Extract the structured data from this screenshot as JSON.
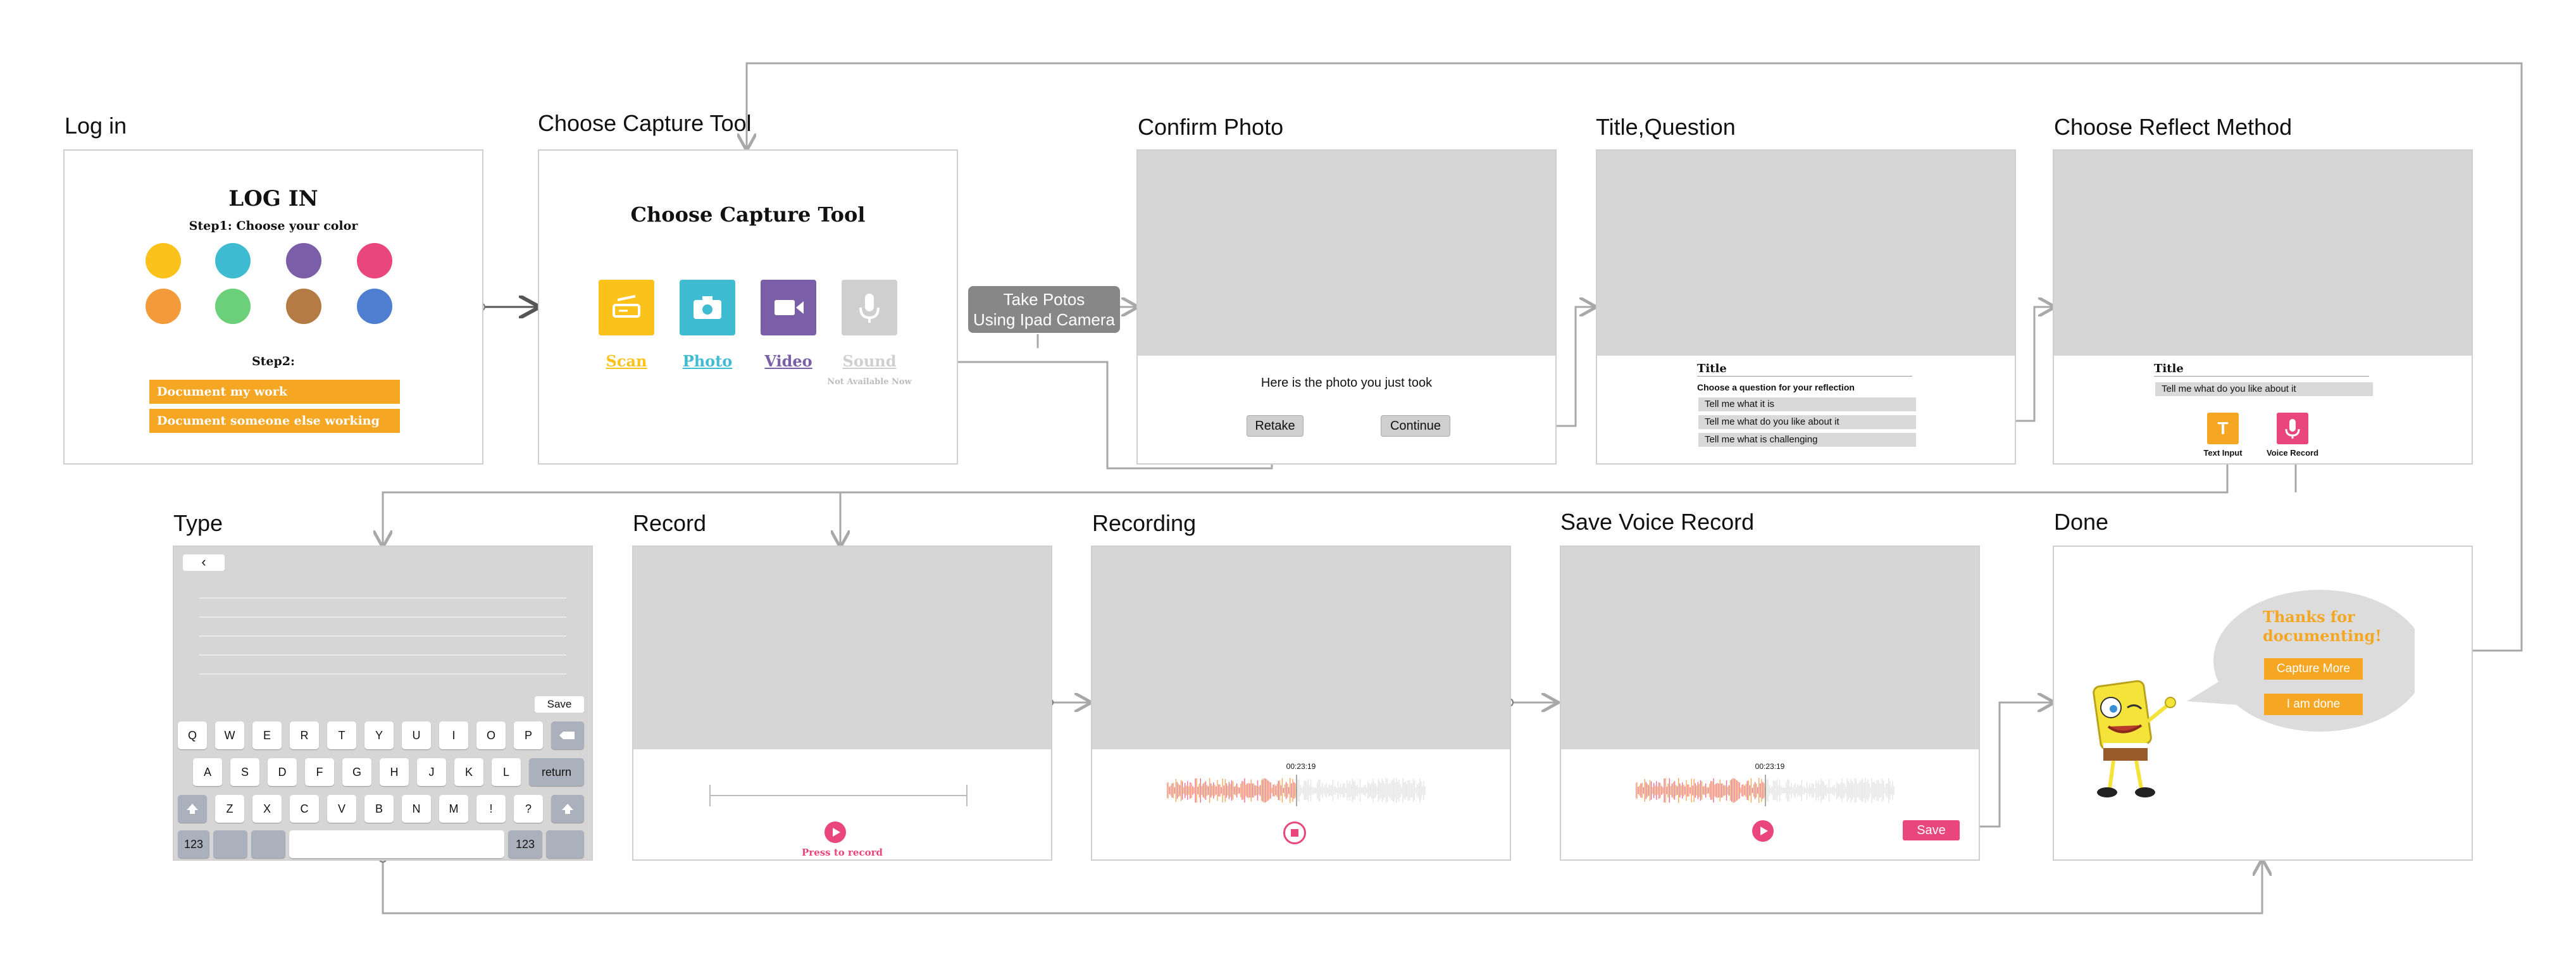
{
  "colors": {
    "orange": "#f5a623",
    "pink": "#e8467c",
    "teal": "#3fbcd2",
    "purple": "#7b5ea8",
    "yellow": "#fbc21b",
    "gray_area": "#d6d6d6",
    "connector": "#a8a8a8"
  },
  "screens": {
    "login": {
      "title": "Log in",
      "heading": "LOG IN",
      "step1": "Step1:  Choose your color",
      "step2": "Step2:",
      "colors": [
        "#fbc21b",
        "#3fbcd2",
        "#7b5ea8",
        "#e8467c",
        "#f39a3b",
        "#6ccf7a",
        "#b47b45",
        "#4f7ed0"
      ],
      "btn_work": "Document my work",
      "btn_someone": "Document someone else working"
    },
    "capture": {
      "title": "Choose Capture Tool",
      "heading": "Choose Capture Tool",
      "tools": [
        {
          "label": "Scan",
          "color": "#fbc21b",
          "icon": "scanner-icon"
        },
        {
          "label": "Photo",
          "color": "#3fbcd2",
          "icon": "camera-icon"
        },
        {
          "label": "Video",
          "color": "#7b5ea8",
          "icon": "video-camera-icon"
        },
        {
          "label": "Sound",
          "color": "#cfcfcf",
          "icon": "microphone-icon"
        }
      ],
      "not_available": "Not Available Now"
    },
    "take_photos": {
      "line1": "Take Potos",
      "line2": "Using Ipad Camera"
    },
    "confirm": {
      "title": "Confirm Photo",
      "message": "Here is the photo you just took",
      "retake": "Retake",
      "continue": "Continue"
    },
    "title_question": {
      "title": "Title,Question",
      "field_label": "Title",
      "prompt": "Choose a question for your reflection",
      "questions": [
        "Tell me what it is",
        "Tell me what do you like about it",
        "Tell me what is challenging"
      ]
    },
    "reflect": {
      "title": "Choose Reflect Method",
      "field_label": "Title",
      "selected_question": "Tell me what do you like about it",
      "text_input_label": "Text Input",
      "voice_record_label": "Voice Record",
      "text_icon_glyph": "T"
    },
    "type": {
      "title": "Type",
      "back": "‹",
      "save": "Save",
      "row1": [
        "Q",
        "W",
        "E",
        "R",
        "T",
        "Y",
        "U",
        "I",
        "O",
        "P"
      ],
      "row2": [
        "A",
        "S",
        "D",
        "F",
        "G",
        "H",
        "J",
        "K",
        "L"
      ],
      "row3": [
        "Z",
        "X",
        "C",
        "V",
        "B",
        "N",
        "M",
        "!",
        "?"
      ],
      "return_key": "return",
      "num_key": "123"
    },
    "record": {
      "title": "Record",
      "press": "Press to record"
    },
    "recording": {
      "title": "Recording",
      "time": "00:23:19"
    },
    "save_voice": {
      "title": "Save Voice Record",
      "time": "00:23:19",
      "save": "Save"
    },
    "done": {
      "title": "Done",
      "thanks_line1": "Thanks for",
      "thanks_line2": "documenting!",
      "capture_more": "Capture More",
      "done_btn": "I am done"
    }
  }
}
